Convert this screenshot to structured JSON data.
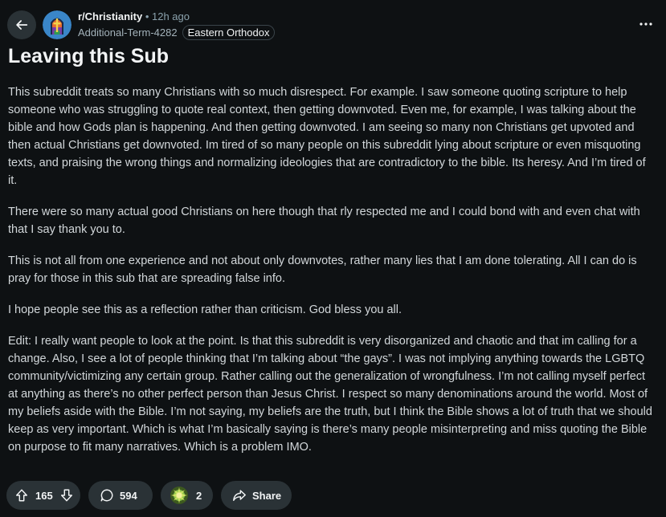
{
  "header": {
    "subreddit": "r/Christianity",
    "separator": "•",
    "time_ago": "12h ago",
    "author": "Additional-Term-4282",
    "flair": "Eastern Orthodox"
  },
  "post": {
    "title": "Leaving this Sub",
    "paragraphs": [
      "This subreddit treats so many Christians with so much disrespect. For example. I saw someone quoting scripture to help someone who was struggling to quote real context, then getting downvoted. Even me, for example, I was talking about the bible and how Gods plan is happening. And then getting downvoted. I am seeing so many non Christians get upvoted and then actual Christians get downvoted. Im tired of so many people on this subreddit lying about scripture or even misquoting texts, and praising the wrong things and normalizing ideologies that are contradictory to the bible. Its heresy. And I’m tired of it.",
      "There were so many actual good Christians on here though that rly respected me and I could bond with and even chat with that I say thank you to.",
      "This is not all from one experience and not about only downvotes, rather many lies that I am done tolerating. All I can do is pray for those in this sub that are spreading false info.",
      "I hope people see this as a reflection rather than criticism. God bless you all.",
      "Edit: I really want people to look at the point. Is that this subreddit is very disorganized and chaotic and that im calling for a change. Also, I see a lot of people thinking that I’m talking about “the gays”. I was not implying anything towards the LGBTQ community/victimizing any certain group. Rather calling out the generalization of wrongfulness. I’m not calling myself perfect at anything as there’s no other perfect person than Jesus Christ. I respect so many denominations around the world. Most of my beliefs aside with the Bible. I’m not saying, my beliefs are the truth, but I think the Bible shows a lot of truth that we should keep as very important. Which is what I’m basically saying is there’s many people misinterpreting and miss quoting the Bible on purpose to fit many narratives. Which is a problem IMO."
    ]
  },
  "actions": {
    "votes": "165",
    "comments": "594",
    "awards": "2",
    "share_label": "Share"
  },
  "icons": {
    "back": "arrow-left-icon",
    "more": "ellipsis-icon",
    "upvote": "upvote-arrow-icon",
    "downvote": "downvote-arrow-icon",
    "comment": "comment-bubble-icon",
    "award": "award-icon",
    "share": "share-arrow-icon"
  },
  "colors": {
    "background": "#0e1113",
    "pill": "#2a3236",
    "text": "#d2d7da",
    "muted": "#8ba2ad"
  }
}
